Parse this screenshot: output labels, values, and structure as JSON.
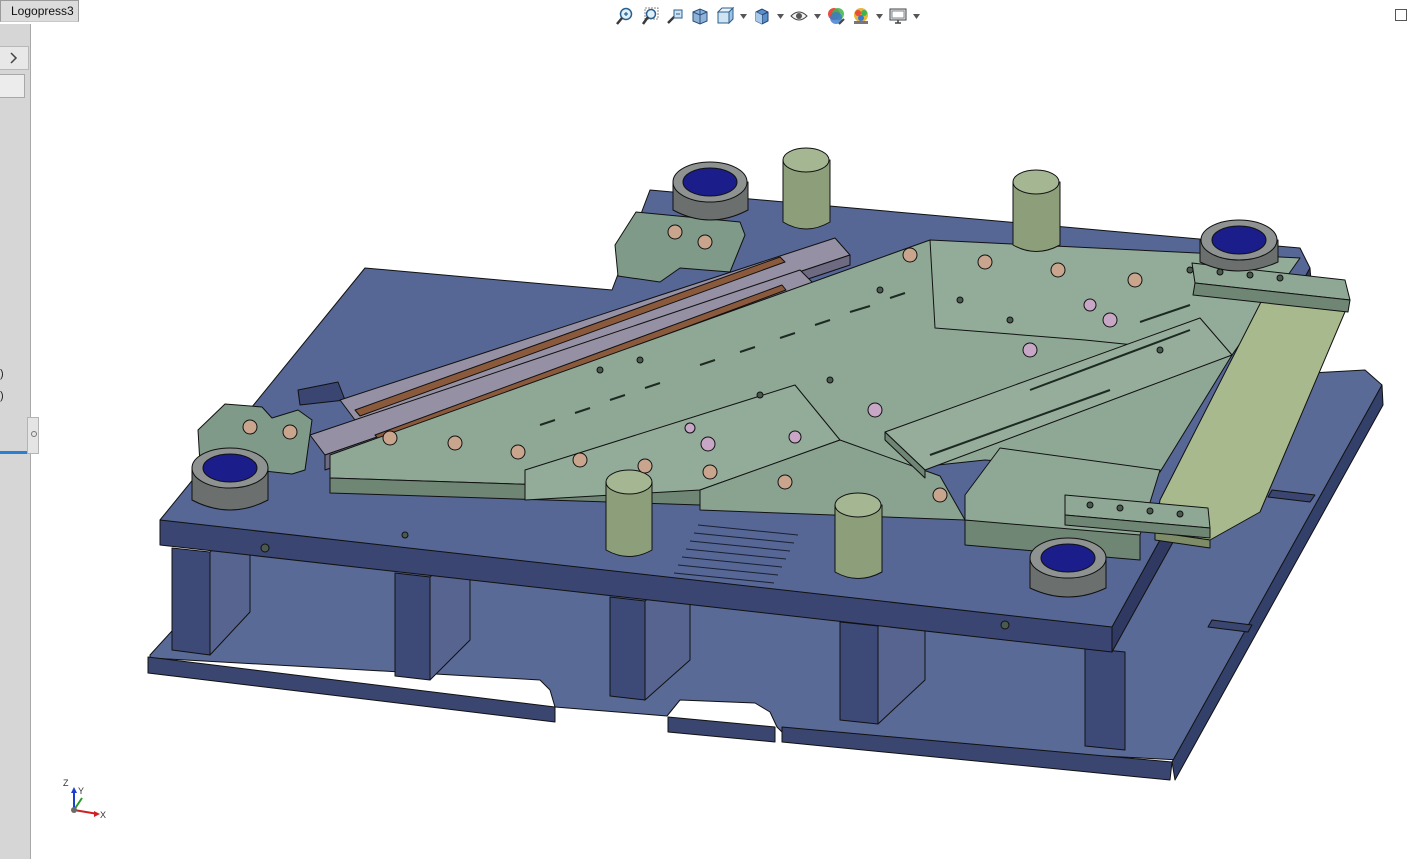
{
  "panel": {
    "tab_label": "Logopress3",
    "paren_1": ")",
    "paren_2": ")"
  },
  "toolbar": {
    "buttons": [
      {
        "name": "zoom-to-fit-icon"
      },
      {
        "name": "zoom-to-area-icon"
      },
      {
        "name": "previous-view-icon"
      },
      {
        "name": "section-view-icon"
      },
      {
        "name": "view-orientation-icon",
        "dropdown": true
      },
      {
        "name": "display-style-icon",
        "dropdown": true
      },
      {
        "name": "hide-show-items-icon",
        "dropdown": true
      },
      {
        "name": "edit-appearance-icon"
      },
      {
        "name": "apply-scene-icon",
        "dropdown": true
      },
      {
        "name": "view-settings-icon",
        "dropdown": true
      }
    ]
  },
  "triad": {
    "z": "Z",
    "y": "Y",
    "x": "X"
  },
  "colors": {
    "base_plate": "#5a6a96",
    "base_plate_side": "#3b4670",
    "die_plate": "#7f9a88",
    "die_plate_top": "#9db2a1",
    "insert": "#a9b98e",
    "pillar": "#8c9f7a",
    "bushing": "#1a1d8a",
    "highlight": "#2a7fd4"
  }
}
